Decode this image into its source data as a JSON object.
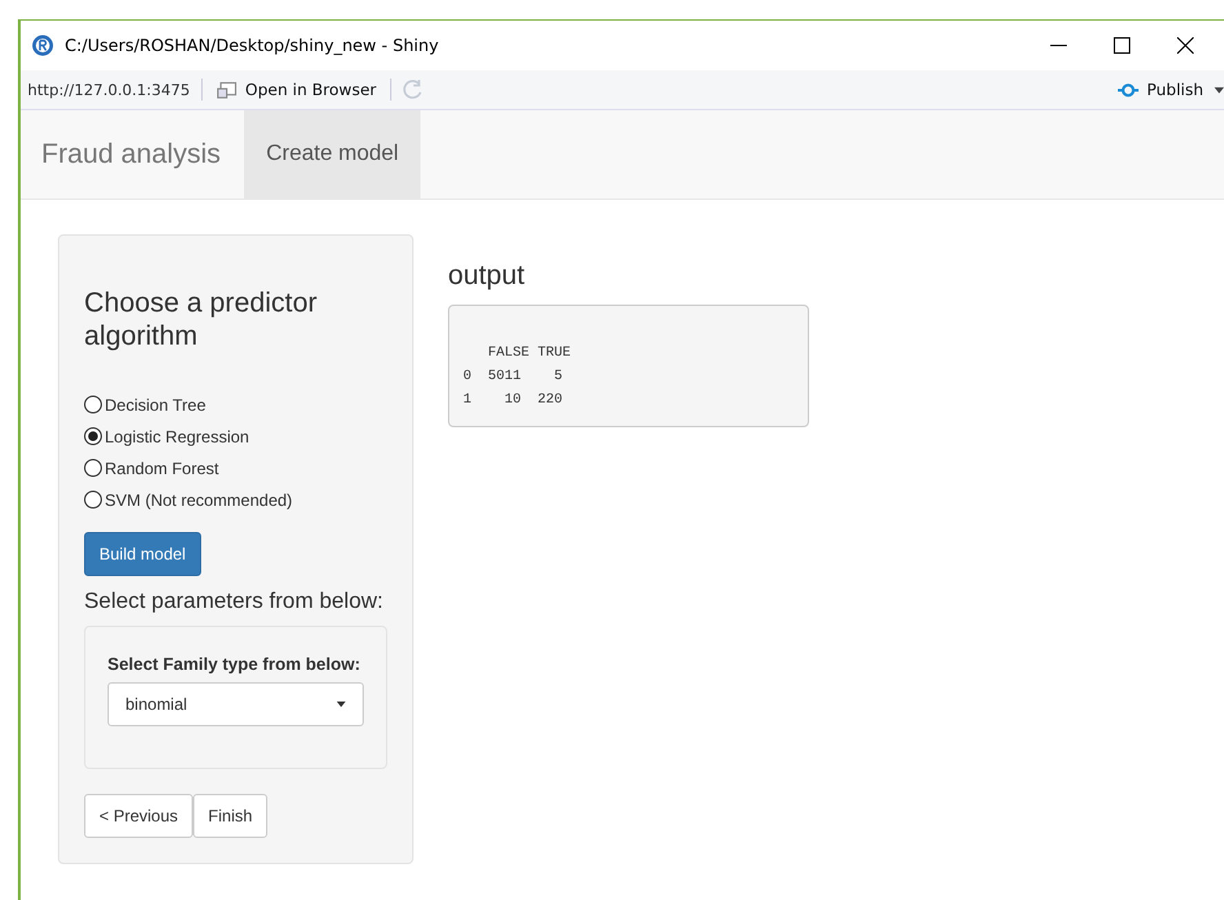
{
  "window": {
    "title": "C:/Users/ROSHAN/Desktop/shiny_new - Shiny"
  },
  "toolbar": {
    "url": "http://127.0.0.1:3475",
    "open_in_browser": "Open in Browser",
    "publish": "Publish"
  },
  "navbar": {
    "brand": "Fraud analysis",
    "tabs": [
      {
        "label": "Create model",
        "selected": true
      }
    ]
  },
  "sidebar": {
    "heading": "Choose a predictor algorithm",
    "options": [
      {
        "label": "Decision Tree",
        "selected": false
      },
      {
        "label": "Logistic Regression",
        "selected": true
      },
      {
        "label": "Random Forest",
        "selected": false
      },
      {
        "label": "SVM (Not recommended)",
        "selected": false
      }
    ],
    "build_button": "Build model",
    "params_label": "Select parameters from below:",
    "family_label": "Select Family type from below:",
    "family_value": "binomial",
    "buttons": [
      "< Previous",
      "Finish"
    ]
  },
  "output": {
    "title": "output",
    "lines": [
      "   FALSE TRUE",
      "0  5011    5",
      "1    10  220"
    ]
  }
}
